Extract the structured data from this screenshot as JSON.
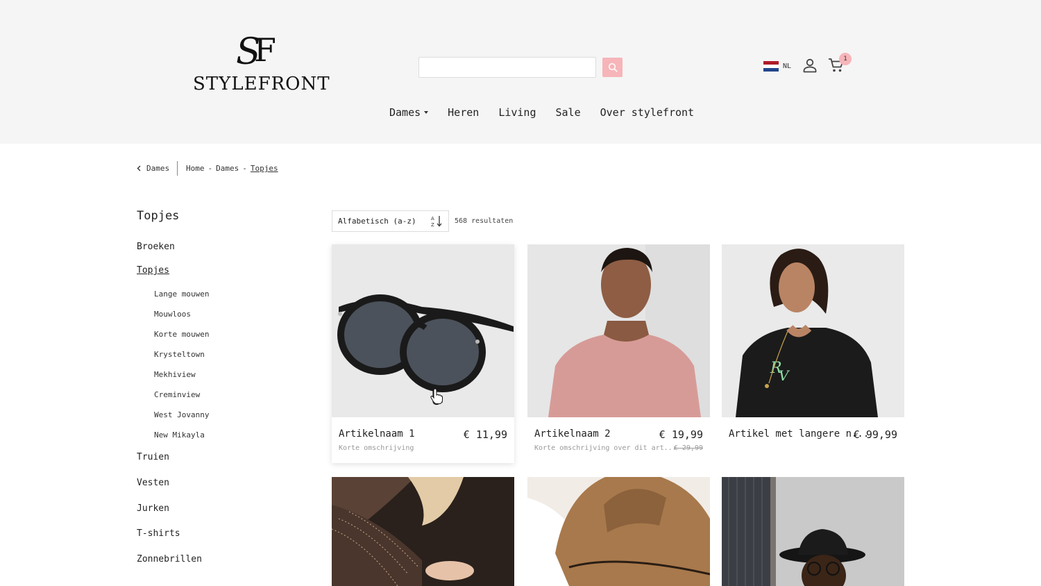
{
  "brand": {
    "name": "STYLEFRONT",
    "monogram": "SF"
  },
  "search": {
    "value": "",
    "placeholder": "",
    "icon": "search-icon"
  },
  "header": {
    "language": {
      "code": "NL",
      "flag_colors": [
        "#ae1c28",
        "#ffffff",
        "#21468b"
      ]
    },
    "cart_count": "1",
    "accent_color": "#f6b5b9"
  },
  "nav": {
    "items": [
      {
        "label": "Dames",
        "has_dropdown": true
      },
      {
        "label": "Heren"
      },
      {
        "label": "Living"
      },
      {
        "label": "Sale"
      },
      {
        "label": "Over stylefront"
      }
    ]
  },
  "breadcrumb": {
    "back_label": "Dames",
    "items": [
      "Home",
      "Dames",
      "Topjes"
    ],
    "separator": "-"
  },
  "sidebar": {
    "title": "Topjes",
    "categories": [
      {
        "label": "Broeken"
      },
      {
        "label": "Topjes",
        "active": true,
        "sub": [
          "Lange mouwen",
          "Mouwloos",
          "Korte mouwen",
          "Krysteltown",
          "Mekhiview",
          "Creminview",
          "West Jovanny",
          "New Mikayla"
        ]
      },
      {
        "label": "Truien"
      },
      {
        "label": "Vesten"
      },
      {
        "label": "Jurken"
      },
      {
        "label": "T-shirts"
      },
      {
        "label": "Zonnebrillen"
      }
    ]
  },
  "toolbar": {
    "sort_value": "Alfabetisch (a-z)",
    "results_text": "568 resultaten"
  },
  "products": [
    {
      "name": "Artikelnaam 1",
      "price": "€ 11,99",
      "description": "Korte omschrijving",
      "old_price": ""
    },
    {
      "name": "Artikelnaam 2",
      "price": "€ 19,99",
      "description": "Korte omschrijving over dit art...",
      "old_price": "€ 29,99"
    },
    {
      "name": "Artikel met langere n...",
      "price": "€ 99,99",
      "description": "",
      "old_price": ""
    }
  ]
}
